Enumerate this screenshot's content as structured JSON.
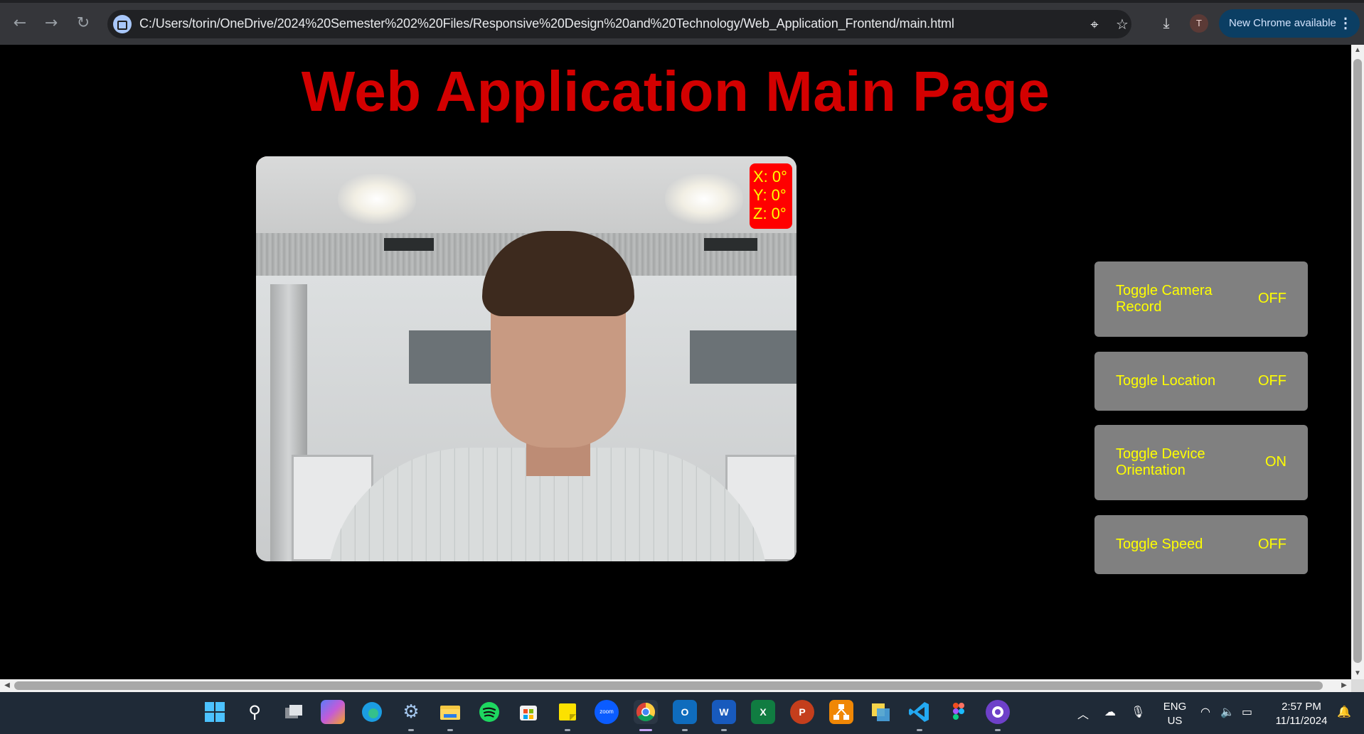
{
  "browser": {
    "url": "C:/Users/torin/OneDrive/2024%20Semester%202%20Files/Responsive%20Design%20and%20Technology/Web_Application_Frontend/main.html",
    "profile_initial": "T",
    "update_label": "New Chrome available",
    "icons": [
      "back-arrow-icon",
      "forward-arrow-icon",
      "reload-icon",
      "site-info-icon",
      "location-pin-icon",
      "bookmark-star-icon",
      "download-icon",
      "kebab-menu-icon"
    ]
  },
  "page": {
    "title": "Web Application Main Page",
    "orientation": {
      "x": "X: 0°",
      "y": "Y: 0°",
      "z": "Z: 0°"
    },
    "toggles": [
      {
        "label": "Toggle Camera Record",
        "state": "OFF"
      },
      {
        "label": "Toggle Location",
        "state": "OFF"
      },
      {
        "label": "Toggle Device Orientation",
        "state": "ON"
      },
      {
        "label": "Toggle Speed",
        "state": "OFF"
      }
    ]
  },
  "taskbar": {
    "apps": [
      "start",
      "search",
      "task-view",
      "copilot",
      "edge",
      "settings",
      "file-explorer",
      "spotify",
      "microsoft-store",
      "sticky-notes",
      "zoom",
      "chrome",
      "outlook",
      "word",
      "excel",
      "powerpoint",
      "draw-io",
      "snipping-tool",
      "vs-code",
      "figma",
      "github-desktop"
    ],
    "zoom_label": "zoom",
    "language": "ENG",
    "region": "US",
    "time": "2:57 PM",
    "date": "11/11/2024"
  }
}
